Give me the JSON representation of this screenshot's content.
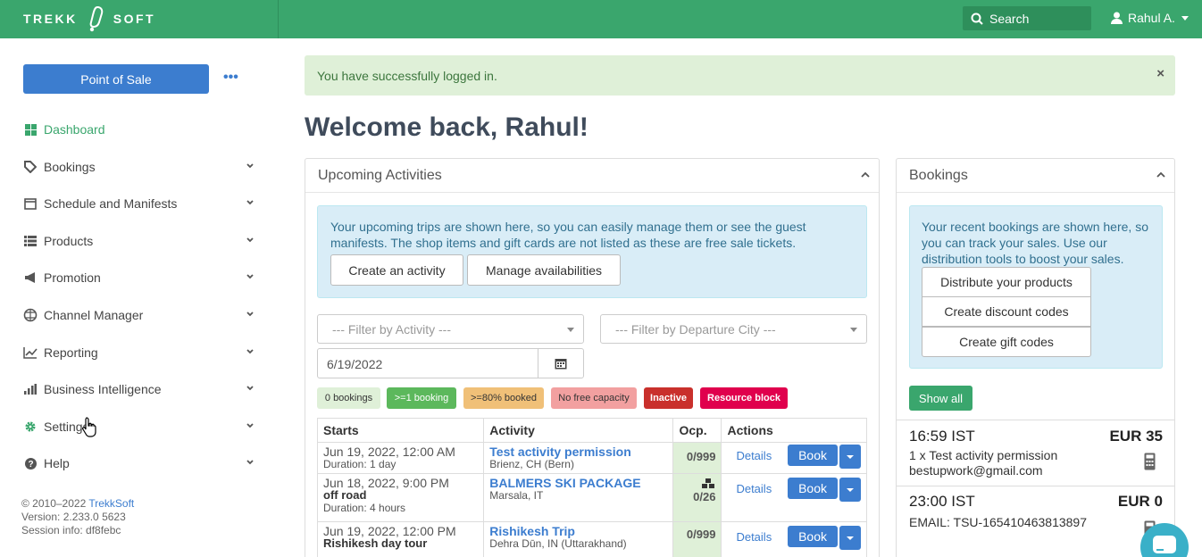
{
  "header": {
    "logo_left": "TREKK",
    "logo_right": "SOFT",
    "search_label": "Search",
    "user_name": "Rahul A."
  },
  "sidebar": {
    "pos_button": "Point of Sale",
    "more": "•••",
    "items": [
      {
        "label": "Dashboard",
        "icon": "dashboard-icon"
      },
      {
        "label": "Bookings",
        "icon": "tag-icon"
      },
      {
        "label": "Schedule and Manifests",
        "icon": "calendar-icon"
      },
      {
        "label": "Products",
        "icon": "list-icon"
      },
      {
        "label": "Promotion",
        "icon": "megaphone-icon"
      },
      {
        "label": "Channel Manager",
        "icon": "network-icon"
      },
      {
        "label": "Reporting",
        "icon": "line-chart-icon"
      },
      {
        "label": "Business Intelligence",
        "icon": "bar-chart-icon"
      },
      {
        "label": "Settings",
        "icon": "gear-icon"
      },
      {
        "label": "Help",
        "icon": "question-icon"
      }
    ],
    "footer": {
      "copyright": "© 2010–2022 ",
      "brand": "TrekkSoft",
      "version": "Version: 2.233.0 5623",
      "session": "Session info: df8febc"
    }
  },
  "alert": {
    "message": "You have successfully logged in.",
    "close": "×"
  },
  "welcome": "Welcome back, Rahul!",
  "upcoming": {
    "title": "Upcoming Activities",
    "info": "Your upcoming trips are shown here, so you can easily manage them or see the guest manifests. The shop items and gift cards are not listed as these are free sale tickets.",
    "create_activity": "Create an activity",
    "manage_availabilities": "Manage availabilities",
    "filter_activity": "--- Filter by Activity ---",
    "filter_city": "--- Filter by Departure City ---",
    "date": "6/19/2022",
    "legend": [
      {
        "label": "0 bookings",
        "bg": "#dff0d8",
        "fg": "#333"
      },
      {
        "label": ">=1 booking",
        "bg": "#5cb85c",
        "fg": "#fff"
      },
      {
        "label": ">=80% booked",
        "bg": "#f0c078",
        "fg": "#333"
      },
      {
        "label": "No free capacity",
        "bg": "#f2a0a0",
        "fg": "#333"
      },
      {
        "label": "Inactive",
        "bg": "#c9302c",
        "fg": "#fff"
      },
      {
        "label": "Resource block",
        "bg": "#e0004d",
        "fg": "#fff"
      }
    ],
    "columns": [
      "Starts",
      "Activity",
      "Ocp.",
      "Actions"
    ],
    "rows": [
      {
        "start": "Jun 19, 2022, 12:00 AM",
        "sub": "",
        "duration": "Duration: 1 day",
        "activity": "Test activity permission",
        "location": "Brienz, CH (Bern)",
        "ocp": "0/999",
        "details": "Details",
        "book": "Book"
      },
      {
        "start": "Jun 18, 2022, 9:00 PM",
        "sub": "off road",
        "duration": "Duration: 4 hours",
        "activity": "BALMERS SKI PACKAGE",
        "location": "Marsala, IT",
        "ocp": "0/26",
        "details": "Details",
        "book": "Book"
      },
      {
        "start": "Jun 19, 2022, 12:00 PM",
        "sub": "Rishikesh day tour",
        "duration": "",
        "activity": "Rishikesh Trip",
        "location": "Dehra Dūn, IN (Uttarakhand)",
        "ocp": "0/999",
        "details": "Details",
        "book": "Book"
      }
    ]
  },
  "bookings": {
    "title": "Bookings",
    "info": "Your recent bookings are shown here, so you can track your sales. Use our distribution tools to boost your sales.",
    "buttons": [
      "Distribute your products",
      "Create discount codes",
      "Create gift codes"
    ],
    "show_all": "Show all",
    "entries": [
      {
        "time": "16:59 IST",
        "amount": "EUR 35",
        "line1": "1 x Test activity permission",
        "line2": "bestupwork@gmail.com"
      },
      {
        "time": "23:00 IST",
        "amount": "EUR 0",
        "line1": "EMAIL: TSU-165410463813897",
        "line2": ""
      }
    ]
  }
}
